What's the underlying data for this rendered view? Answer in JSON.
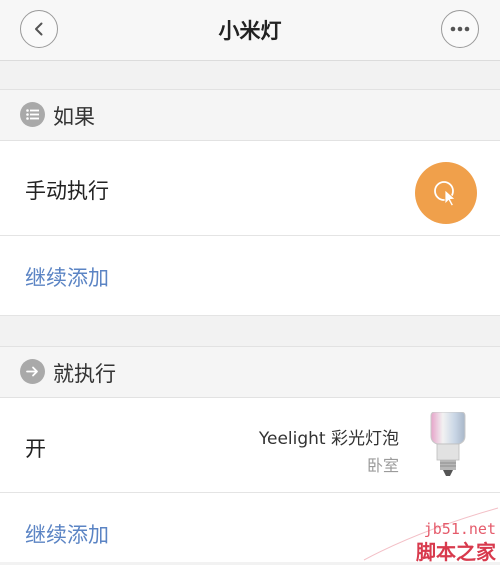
{
  "header": {
    "title": "小米灯",
    "back_icon": "chevron-left-icon",
    "more_icon": "more-icon"
  },
  "if_section": {
    "label": "如果",
    "icon": "list-icon"
  },
  "if_condition": {
    "label": "手动执行",
    "action_icon": "tap-cursor-icon",
    "action_color": "#f0a04b"
  },
  "if_add": {
    "label": "继续添加"
  },
  "then_section": {
    "label": "就执行",
    "icon": "arrow-right-icon"
  },
  "then_action": {
    "label": "开",
    "device_name": "Yeelight 彩光灯泡",
    "device_room": "卧室",
    "device_icon": "bulb-icon"
  },
  "then_add": {
    "label": "继续添加"
  },
  "watermark": {
    "url": "jb51.net",
    "name": "脚本之家"
  },
  "colors": {
    "link": "#5b84c4",
    "background": "#f2f2f2"
  }
}
